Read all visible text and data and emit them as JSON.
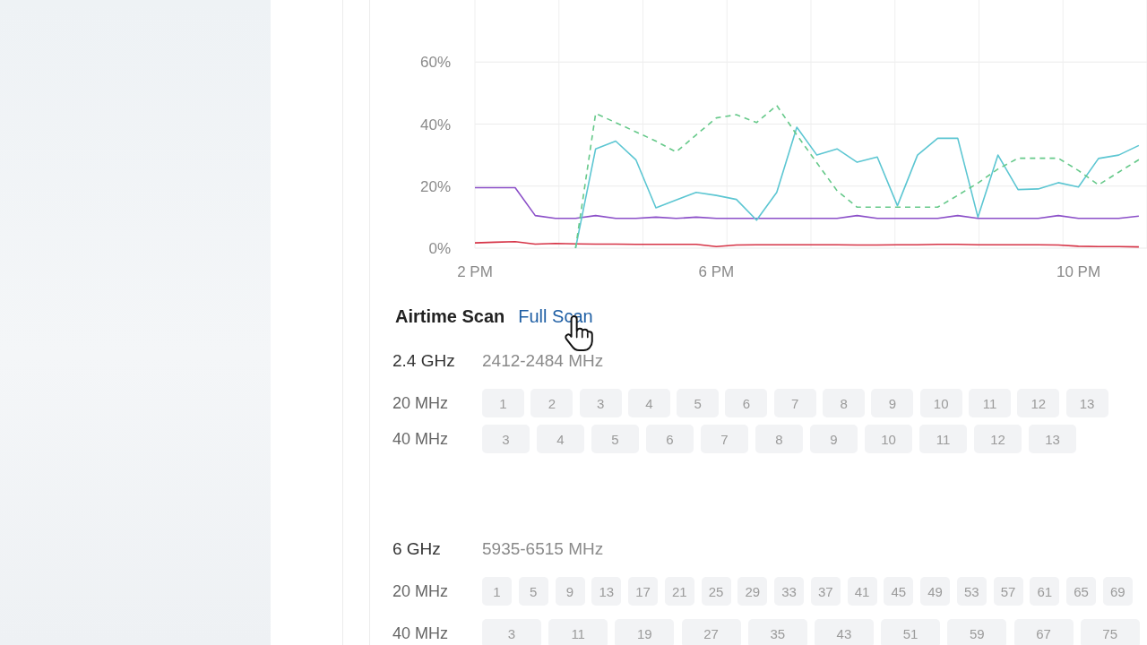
{
  "chart": {
    "chart_data": [
      {
        "type": "line",
        "categories": [
          "2 PM",
          null,
          null,
          null,
          null,
          null,
          null,
          null,
          null,
          null,
          null,
          null,
          "6 PM",
          null,
          null,
          null,
          null,
          null,
          null,
          null,
          null,
          null,
          null,
          null,
          null,
          null,
          null,
          null,
          null,
          null,
          "10 PM",
          null,
          null,
          null
        ],
        "ylim": [
          0,
          80
        ],
        "yticks": [
          {
            "value": 0,
            "label": "0%"
          },
          {
            "value": 20,
            "label": "20%"
          },
          {
            "value": 40,
            "label": "40%"
          },
          {
            "value": 60,
            "label": "60%"
          }
        ],
        "grid": true,
        "series": [
          {
            "color": "#d63447",
            "values": [
              1.7,
              1.9,
              2.1,
              1.3,
              1.5,
              1.4,
              1.3,
              1.3,
              1.2,
              1.2,
              1.2,
              1.2,
              0.5,
              1.0,
              1.1,
              1.1,
              1.1,
              1.1,
              1.1,
              1.0,
              1.0,
              1.1,
              1.1,
              1.2,
              1.2,
              1.1,
              1.1,
              1.1,
              1.1,
              1.0,
              0.6,
              0.5,
              0.5,
              0.4
            ]
          },
          {
            "color": "#8b4fc8",
            "values": [
              19.5,
              19.5,
              19.5,
              10.5,
              9.6,
              9.6,
              10.5,
              9.6,
              9.6,
              10,
              9.6,
              10,
              9.6,
              9.6,
              9.6,
              9.6,
              9.6,
              9.6,
              9.6,
              10.5,
              9.6,
              9.6,
              9.6,
              9.6,
              10.5,
              9.6,
              9.6,
              9.6,
              9.6,
              10.5,
              9.6,
              9.6,
              9.6,
              10.3
            ]
          },
          {
            "color": "#5cc6d2",
            "values": [
              null,
              null,
              null,
              null,
              null,
              0,
              32,
              34.5,
              28.5,
              13,
              15.5,
              18,
              17,
              15.7,
              9,
              18,
              39,
              30,
              32,
              27.7,
              29.4,
              13.7,
              30,
              35.4,
              35.4,
              10,
              30,
              18.9,
              19.1,
              21.1,
              19.7,
              28.9,
              30,
              33.1
            ]
          },
          {
            "color": "#66c98a",
            "line_style": "dashed",
            "values": [
              null,
              null,
              null,
              null,
              null,
              0,
              43.4,
              40.5,
              37.5,
              34.5,
              31,
              36.5,
              42,
              43,
              40.5,
              46,
              36.5,
              27.5,
              18.5,
              13.2,
              13.2,
              13.2,
              13.2,
              13.2,
              17,
              21,
              25.5,
              29,
              29,
              29,
              25,
              20.4,
              24.5,
              28.5
            ]
          }
        ]
      }
    ]
  },
  "airtime_scan": {
    "title": "Airtime Scan",
    "link": "Full Scan"
  },
  "bands": [
    {
      "name": "2.4 GHz",
      "range": "2412-2484 MHz",
      "rows": [
        {
          "label": "20 MHz",
          "channels": [
            "1",
            "2",
            "3",
            "4",
            "5",
            "6",
            "7",
            "8",
            "9",
            "10",
            "11",
            "12",
            "13"
          ]
        },
        {
          "label": "40 MHz",
          "channels": [
            "3",
            "4",
            "5",
            "6",
            "7",
            "8",
            "9",
            "10",
            "11",
            "12",
            "13"
          ]
        }
      ]
    },
    {
      "name": "6 GHz",
      "range": "5935-6515 MHz",
      "rows": [
        {
          "label": "20 MHz",
          "channels": [
            "1",
            "5",
            "9",
            "13",
            "17",
            "21",
            "25",
            "29",
            "33",
            "37",
            "41",
            "45",
            "49",
            "53",
            "57",
            "61",
            "65",
            "69"
          ]
        },
        {
          "label": "40 MHz",
          "channels": [
            "3",
            "11",
            "19",
            "27",
            "35",
            "43",
            "51",
            "59",
            "67",
            "75"
          ]
        }
      ]
    }
  ]
}
